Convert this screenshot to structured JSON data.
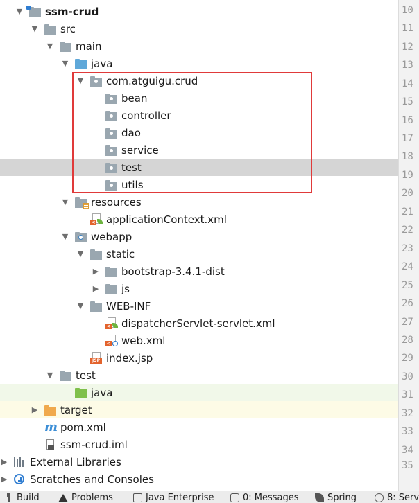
{
  "project_tree": {
    "items": [
      {
        "label": "ssm-crud",
        "icon": "module-folder-icon",
        "expanded": true
      },
      {
        "label": "src",
        "icon": "folder-icon",
        "expanded": true
      },
      {
        "label": "main",
        "icon": "folder-icon",
        "expanded": true
      },
      {
        "label": "java",
        "icon": "source-root-folder-icon",
        "expanded": true
      },
      {
        "label": "com.atguigu.crud",
        "icon": "package-icon",
        "expanded": true
      },
      {
        "label": "bean",
        "icon": "package-icon"
      },
      {
        "label": "controller",
        "icon": "package-icon"
      },
      {
        "label": "dao",
        "icon": "package-icon"
      },
      {
        "label": "service",
        "icon": "package-icon"
      },
      {
        "label": "test",
        "icon": "package-icon",
        "selected": true
      },
      {
        "label": "utils",
        "icon": "package-icon"
      },
      {
        "label": "resources",
        "icon": "resources-folder-icon",
        "expanded": true
      },
      {
        "label": "applicationContext.xml",
        "icon": "spring-xml-file-icon"
      },
      {
        "label": "webapp",
        "icon": "web-folder-icon",
        "expanded": true
      },
      {
        "label": "static",
        "icon": "folder-icon",
        "expanded": true
      },
      {
        "label": "bootstrap-3.4.1-dist",
        "icon": "folder-icon",
        "expanded": false
      },
      {
        "label": "js",
        "icon": "folder-icon",
        "expanded": false
      },
      {
        "label": "WEB-INF",
        "icon": "folder-icon",
        "expanded": true
      },
      {
        "label": "dispatcherServlet-servlet.xml",
        "icon": "spring-xml-file-icon"
      },
      {
        "label": "web.xml",
        "icon": "web-xml-file-icon"
      },
      {
        "label": "index.jsp",
        "icon": "jsp-file-icon"
      },
      {
        "label": "test",
        "icon": "folder-icon",
        "expanded": true
      },
      {
        "label": "java",
        "icon": "test-root-folder-icon"
      },
      {
        "label": "target",
        "icon": "excluded-folder-icon",
        "expanded": false
      },
      {
        "label": "pom.xml",
        "icon": "maven-file-icon"
      },
      {
        "label": "ssm-crud.iml",
        "icon": "iml-file-icon"
      },
      {
        "label": "External Libraries",
        "icon": "libraries-icon",
        "expanded": false
      },
      {
        "label": "Scratches and Consoles",
        "icon": "scratches-icon",
        "expanded": false
      }
    ]
  },
  "gutter": {
    "line_numbers": [
      "10",
      "11",
      "12",
      "13",
      "14",
      "15",
      "16",
      "17",
      "18",
      "19",
      "20",
      "21",
      "22",
      "23",
      "24",
      "25",
      "26",
      "27",
      "28",
      "29",
      "30",
      "31",
      "32",
      "33",
      "34",
      "35"
    ]
  },
  "bottom_bar": {
    "tabs": [
      {
        "label": "Build",
        "icon": "hammer-icon"
      },
      {
        "label": "Problems",
        "icon": "warning-icon"
      },
      {
        "label": "Java Enterprise",
        "icon": "java-enterprise-icon"
      },
      {
        "label": "0: Messages",
        "icon": "messages-icon"
      },
      {
        "label": "Spring",
        "icon": "spring-icon"
      },
      {
        "label": "8: Serv",
        "icon": "services-icon"
      }
    ]
  },
  "colors": {
    "selection": "#d5d5d5",
    "highlight_box": "#e03a3a",
    "package_folder": "#9aa7b0",
    "source_folder": "#5fa8d9",
    "test_folder": "#7fc04b",
    "excluded_folder": "#f0a94d"
  }
}
